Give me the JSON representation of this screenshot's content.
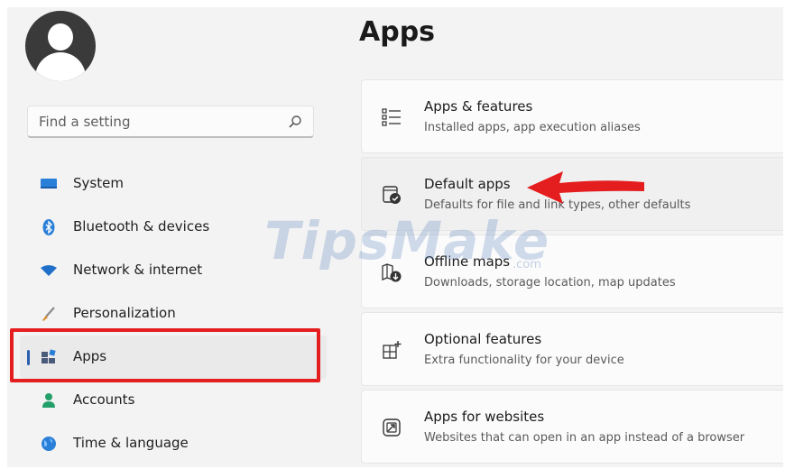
{
  "search": {
    "placeholder": "Find a setting"
  },
  "nav": {
    "items": [
      {
        "label": "System",
        "icon": "monitor-icon"
      },
      {
        "label": "Bluetooth & devices",
        "icon": "bluetooth-icon"
      },
      {
        "label": "Network & internet",
        "icon": "wifi-icon"
      },
      {
        "label": "Personalization",
        "icon": "brush-icon"
      },
      {
        "label": "Apps",
        "icon": "apps-icon",
        "active": true
      },
      {
        "label": "Accounts",
        "icon": "person-icon"
      },
      {
        "label": "Time & language",
        "icon": "globe-clock-icon"
      }
    ]
  },
  "main": {
    "title": "Apps",
    "cards": [
      {
        "title": "Apps & features",
        "subtitle": "Installed apps, app execution aliases",
        "icon": "list-icon"
      },
      {
        "title": "Default apps",
        "subtitle": "Defaults for file and link types, other defaults",
        "icon": "default-apps-icon"
      },
      {
        "title": "Offline maps",
        "subtitle": "Downloads, storage location, map updates",
        "icon": "map-download-icon"
      },
      {
        "title": "Optional features",
        "subtitle": "Extra functionality for your device",
        "icon": "add-feature-icon"
      },
      {
        "title": "Apps for websites",
        "subtitle": "Websites that can open in an app instead of a browser",
        "icon": "open-external-icon"
      }
    ]
  },
  "watermark": {
    "brand": "TipsMake",
    "suffix": ".com"
  },
  "colors": {
    "accent": "#2d5fb0",
    "highlight": "#e41e1e",
    "background": "#f3f3f3"
  }
}
